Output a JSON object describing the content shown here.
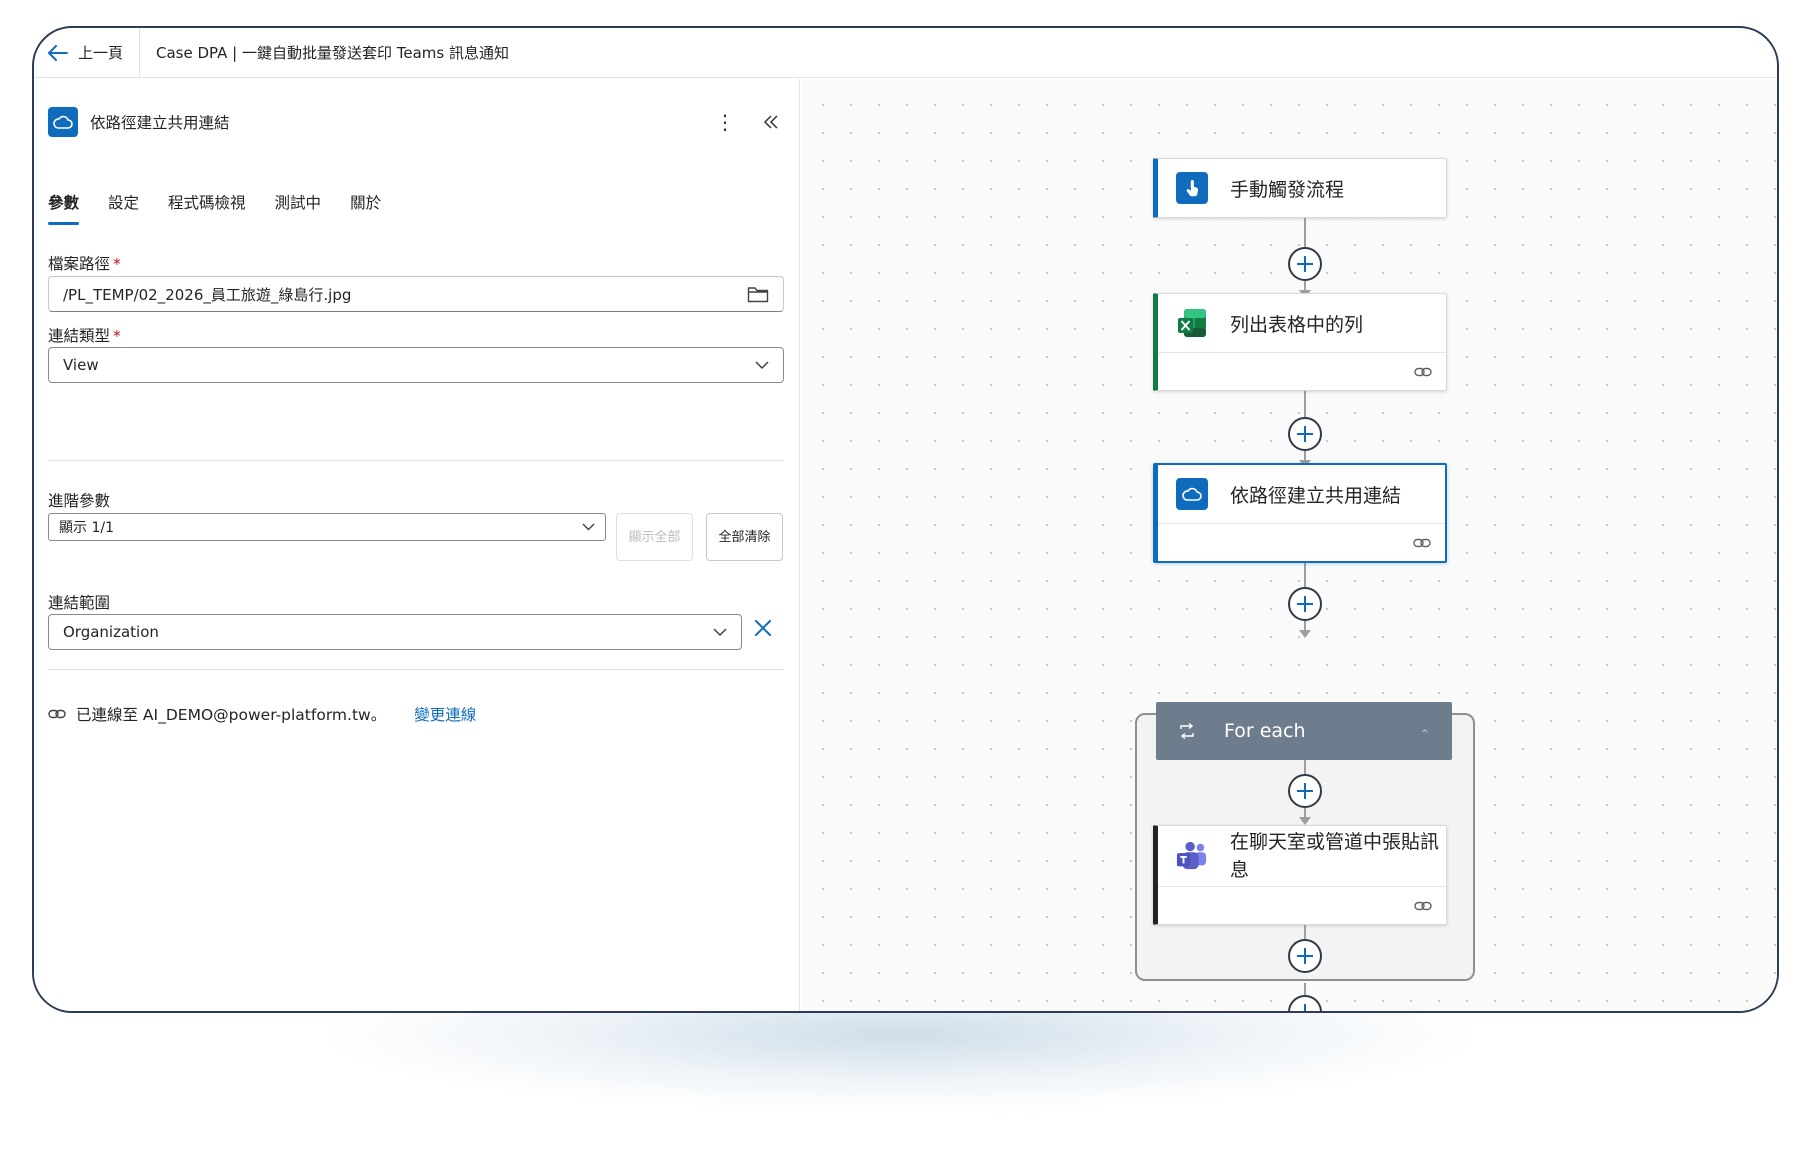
{
  "topbar": {
    "back_label": "上一頁",
    "breadcrumb": "Case DPA | 一鍵自動批量發送套印 Teams 訊息通知"
  },
  "panel": {
    "title": "依路徑建立共用連結",
    "tabs": [
      {
        "label": "參數",
        "active": true
      },
      {
        "label": "設定",
        "active": false
      },
      {
        "label": "程式碼檢視",
        "active": false
      },
      {
        "label": "測試中",
        "active": false
      },
      {
        "label": "關於",
        "active": false
      }
    ],
    "file_path": {
      "label": "檔案路徑",
      "required_mark": "*",
      "value": "/PL_TEMP/02_2026_員工旅遊_綠島行.jpg"
    },
    "link_type": {
      "label": "連結類型",
      "required_mark": "*",
      "value": "View"
    },
    "advanced": {
      "label": "進階參數",
      "select_value": "顯示 1/1",
      "show_all_label": "顯示全部",
      "clear_all_label": "全部清除"
    },
    "link_scope": {
      "label": "連結範圍",
      "value": "Organization"
    },
    "connection": {
      "text": "已連線至 AI_DEMO@power-platform.tw。",
      "change_label": "變更連線"
    }
  },
  "canvas": {
    "trigger": {
      "label": "手動觸發流程"
    },
    "excel_step": {
      "label": "列出表格中的列"
    },
    "share_step": {
      "label": "依路徑建立共用連結"
    },
    "foreach": {
      "label": "For each"
    },
    "teams_step": {
      "label": "在聊天室或管道中張貼訊息"
    }
  },
  "colors": {
    "accent": "#0f6cbd",
    "excel_green": "#107c41",
    "foreach_header": "#6e7d8e",
    "teams_purple": "#5b5fc7",
    "danger": "#c50f1f"
  },
  "icons": {
    "back": "arrow-left-icon",
    "onedrive": "cloud-icon",
    "kebab": "more-vertical-icon",
    "collapse": "double-chevron-left-icon",
    "folder": "folder-icon",
    "chevron": "chevron-down-icon",
    "clear": "close-icon",
    "link": "link-icon",
    "trigger": "touch-icon",
    "excel": "excel-icon",
    "teams": "teams-icon",
    "loop": "loop-icon",
    "plus": "plus-icon"
  }
}
